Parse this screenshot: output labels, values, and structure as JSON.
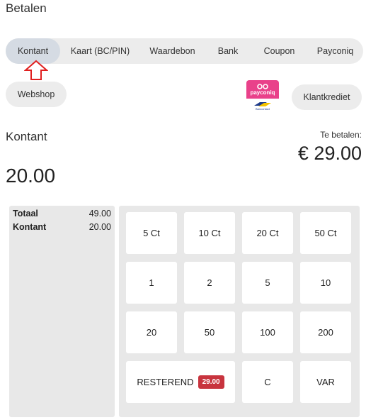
{
  "page": {
    "title": "Betalen"
  },
  "methods": [
    {
      "label": "Kontant",
      "active": true
    },
    {
      "label": "Kaart (BC/PIN)",
      "active": false
    },
    {
      "label": "Waardebon",
      "active": false
    },
    {
      "label": "Bank",
      "active": false
    },
    {
      "label": "Coupon",
      "active": false
    },
    {
      "label": "Payconiq",
      "active": false
    }
  ],
  "extra_methods": {
    "webshop": "Webshop",
    "klantkrediet": "Klantkrediet"
  },
  "payconiq_logo": {
    "brand": "payconiq",
    "sub": "Bancontact"
  },
  "section": {
    "title": "Kontant",
    "amount": "20.00"
  },
  "due": {
    "label": "Te betalen:",
    "value": "€ 29.00"
  },
  "summary": [
    {
      "label": "Totaal",
      "value": "49.00"
    },
    {
      "label": "Kontant",
      "value": "20.00"
    }
  ],
  "keypad": {
    "row1": [
      "5 Ct",
      "10 Ct",
      "20 Ct",
      "50 Ct"
    ],
    "row2": [
      "1",
      "2",
      "5",
      "10"
    ],
    "row3": [
      "20",
      "50",
      "100",
      "200"
    ],
    "resterend_label": "RESTEREND",
    "resterend_value": "29.00",
    "clear": "C",
    "var": "VAR"
  },
  "colors": {
    "accent_red": "#c8343e",
    "payconiq_pink": "#e9418a",
    "pill_bg": "#ececec"
  }
}
